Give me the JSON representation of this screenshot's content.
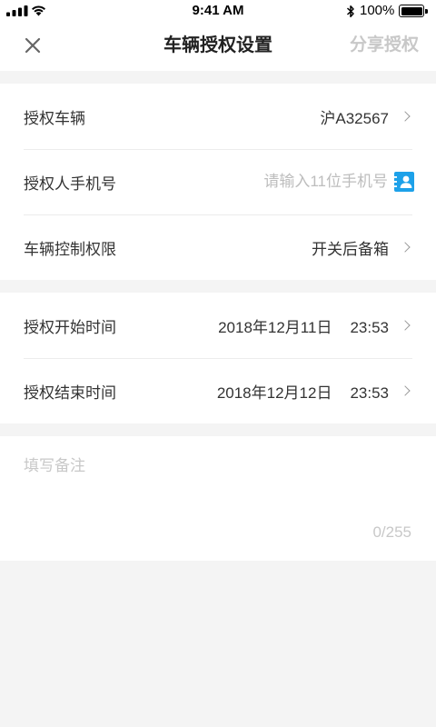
{
  "status_bar": {
    "time": "9:41 AM",
    "battery_percent": "100%",
    "battery_level": 1.0,
    "signal_bars": 4,
    "icons": [
      "signal-icon",
      "wifi-icon",
      "bluetooth-icon",
      "battery-icon"
    ]
  },
  "nav": {
    "close_icon": "close-icon",
    "title": "车辆授权设置",
    "share_label": "分享授权",
    "share_enabled": false
  },
  "form": {
    "vehicle": {
      "label": "授权车辆",
      "value": "沪A32567",
      "icon": "chevron-right-icon"
    },
    "phone": {
      "label": "授权人手机号",
      "placeholder": "请输入11位手机号",
      "icon": "contacts-icon"
    },
    "permission": {
      "label": "车辆控制权限",
      "value": "开关后备箱",
      "icon": "chevron-right-icon"
    },
    "start_time": {
      "label": "授权开始时间",
      "date": "2018年12月11日",
      "time": "23:53",
      "icon": "chevron-right-icon"
    },
    "end_time": {
      "label": "授权结束时间",
      "date": "2018年12月12日",
      "time": "23:53",
      "icon": "chevron-right-icon"
    },
    "remark": {
      "placeholder": "填写备注",
      "counter": "0/255"
    }
  },
  "colors": {
    "accent": "#1DA1E9",
    "page_background": "#F4F4F4",
    "disabled_text": "#C8C8C8",
    "placeholder": "#BDBDBD"
  }
}
